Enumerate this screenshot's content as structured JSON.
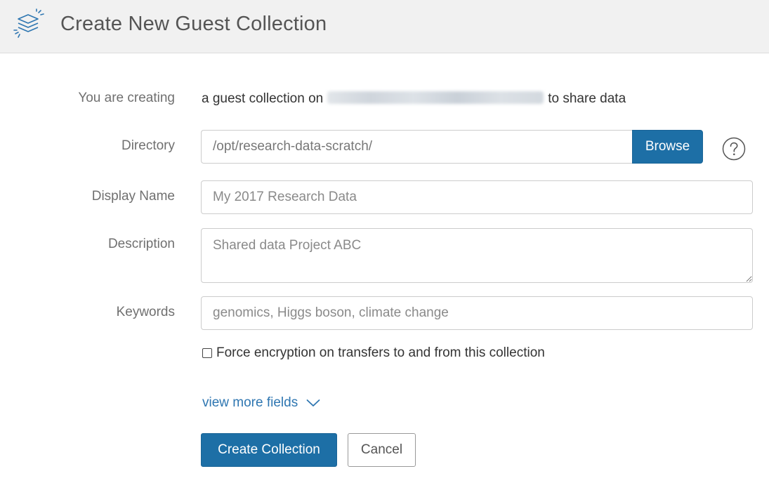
{
  "header": {
    "title": "Create New Guest Collection",
    "icon": "layers-icon"
  },
  "form": {
    "creating": {
      "label": "You are creating",
      "prefix": "a guest collection on",
      "suffix": "to share data"
    },
    "directory": {
      "label": "Directory",
      "value": "/opt/research-data-scratch/",
      "browse_label": "Browse",
      "help_icon": "question-circle-icon"
    },
    "display_name": {
      "label": "Display Name",
      "placeholder": "My 2017 Research Data"
    },
    "description": {
      "label": "Description",
      "placeholder": "Shared data Project ABC"
    },
    "keywords": {
      "label": "Keywords",
      "placeholder": "genomics, Higgs boson, climate change"
    },
    "encryption": {
      "label": "Force encryption on transfers to and from this collection",
      "checked": false
    },
    "more_fields": {
      "label": "view more fields",
      "icon": "chevron-down-icon"
    },
    "actions": {
      "create_label": "Create Collection",
      "cancel_label": "Cancel"
    }
  },
  "colors": {
    "primary": "#1d6fa6",
    "link": "#2e76b1",
    "header_bg": "#f1f1f1"
  }
}
